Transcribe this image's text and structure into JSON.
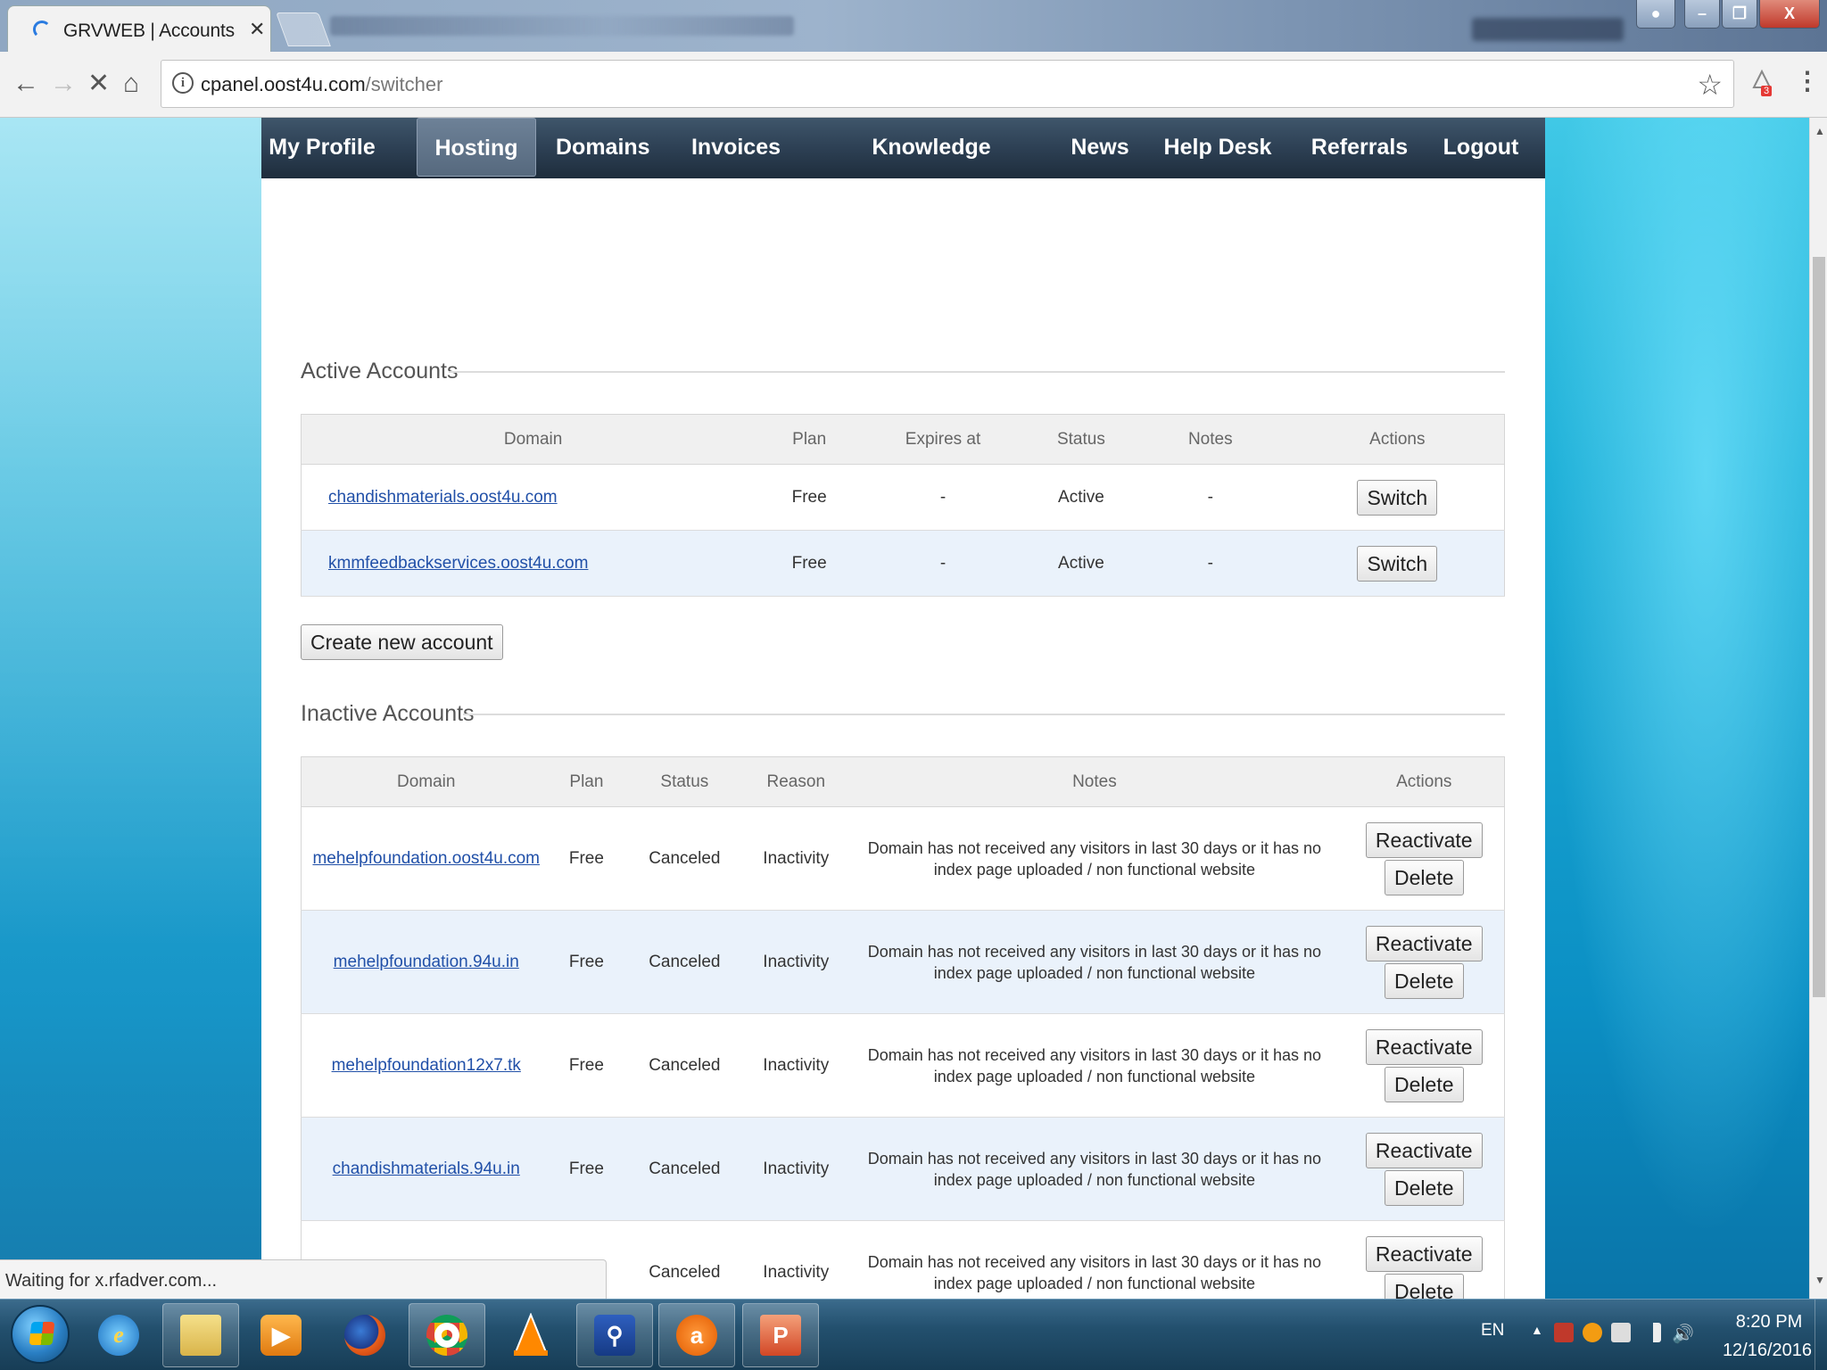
{
  "browser": {
    "tab_title": "GRVWEB | Accounts",
    "url_host": "cpanel.oost4u.com",
    "url_path": "/switcher",
    "extension_badge": "3"
  },
  "nav": {
    "items": [
      {
        "label": "My Profile",
        "active": false
      },
      {
        "label": "Hosting",
        "active": true
      },
      {
        "label": "Domains",
        "active": false
      },
      {
        "label": "Invoices",
        "active": false
      },
      {
        "label": "Knowledge Base",
        "active": false
      },
      {
        "label": "News",
        "active": false
      },
      {
        "label": "Help Desk",
        "active": false
      },
      {
        "label": "Referrals",
        "active": false
      },
      {
        "label": "Logout",
        "active": false
      }
    ]
  },
  "active_accounts": {
    "title": "Active Accounts",
    "columns": [
      "Domain",
      "Plan",
      "Expires at",
      "Status",
      "Notes",
      "Actions"
    ],
    "rows": [
      {
        "domain": "chandishmaterials.oost4u.com",
        "plan": "Free",
        "expires": "-",
        "status": "Active",
        "notes": "-",
        "action": "Switch"
      },
      {
        "domain": "kmmfeedbackservices.oost4u.com",
        "plan": "Free",
        "expires": "-",
        "status": "Active",
        "notes": "-",
        "action": "Switch"
      }
    ]
  },
  "create_button": "Create new account",
  "inactive_accounts": {
    "title": "Inactive Accounts",
    "columns": [
      "Domain",
      "Plan",
      "Status",
      "Reason",
      "Notes",
      "Actions"
    ],
    "rows": [
      {
        "domain": "mehelpfoundation.oost4u.com",
        "plan": "Free",
        "status": "Canceled",
        "reason": "Inactivity",
        "notes_line1": "Domain has not received any visitors in last 30 days or it has no",
        "notes_line2": "index page uploaded / non functional website",
        "action1": "Reactivate",
        "action2": "Delete"
      },
      {
        "domain": "mehelpfoundation.94u.in",
        "plan": "Free",
        "status": "Canceled",
        "reason": "Inactivity",
        "notes_line1": "Domain has not received any visitors in last 30 days or it has no",
        "notes_line2": "index page uploaded / non functional website",
        "action1": "Reactivate",
        "action2": "Delete"
      },
      {
        "domain": "mehelpfoundation12x7.tk",
        "plan": "Free",
        "status": "Canceled",
        "reason": "Inactivity",
        "notes_line1": "Domain has not received any visitors in last 30 days or it has no",
        "notes_line2": "index page uploaded / non functional website",
        "action1": "Reactivate",
        "action2": "Delete"
      },
      {
        "domain": "chandishmaterials.94u.in",
        "plan": "Free",
        "status": "Canceled",
        "reason": "Inactivity",
        "notes_line1": "Domain has not received any visitors in last 30 days or it has no",
        "notes_line2": "index page uploaded / non functional website",
        "action1": "Reactivate",
        "action2": "Delete"
      },
      {
        "domain": "",
        "plan": "",
        "status": "Canceled",
        "reason": "Inactivity",
        "notes_line1": "Domain has not received any visitors in last 30 days or it has no",
        "notes_line2": "index page uploaded / non functional website",
        "action1": "Reactivate",
        "action2": "Delete"
      }
    ]
  },
  "status_bar": "Waiting for x.rfadver.com...",
  "taskbar": {
    "language": "EN",
    "time": "8:20 PM",
    "date": "12/16/2016"
  },
  "colors": {
    "nav_bg": "#2d4054",
    "link": "#2150a8",
    "row_alt": "#eaf2fb",
    "desktop_bg": "#1fb0d8"
  }
}
